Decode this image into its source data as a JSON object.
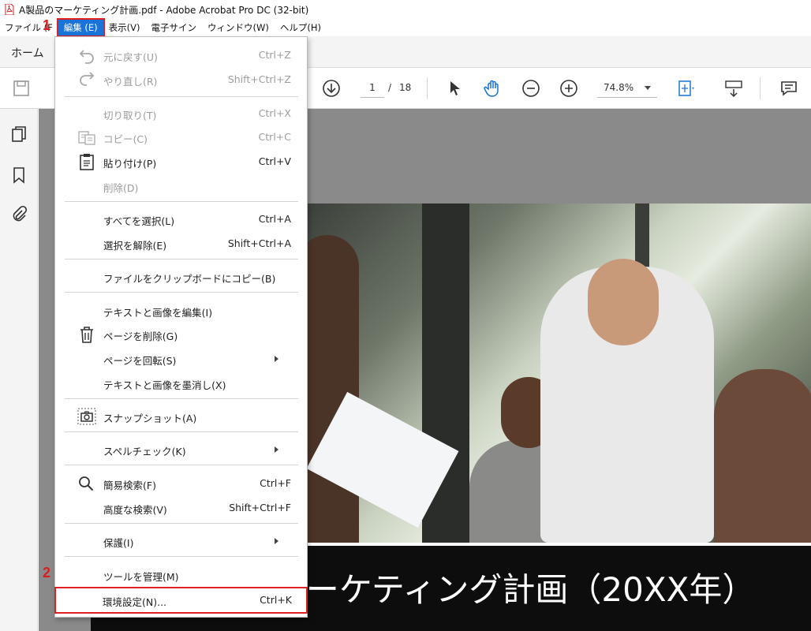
{
  "window": {
    "title": "A製品のマーケティング計画.pdf - Adobe Acrobat Pro DC (32-bit)"
  },
  "menubar": {
    "items": [
      "ファイル (F)",
      "編集 (E)",
      "表示(V)",
      "電子サイン",
      "ウィンドウ(W)",
      "ヘルプ(H)"
    ],
    "visible_first": "ファイル (F",
    "active_index": 1
  },
  "tabs": {
    "home": "ホーム"
  },
  "toolbar": {
    "page_current": "1",
    "page_sep": "/",
    "page_total": "18",
    "zoom": "74.8%"
  },
  "edit_menu": {
    "items": [
      {
        "label": "元に戻す(U)",
        "shortcut": "Ctrl+Z",
        "disabled": true,
        "icon": "undo-icon"
      },
      {
        "label": "やり直し(R)",
        "shortcut": "Shift+Ctrl+Z",
        "disabled": true,
        "icon": "redo-icon"
      },
      {
        "label": "切り取り(T)",
        "shortcut": "Ctrl+X",
        "disabled": true
      },
      {
        "label": "コピー(C)",
        "shortcut": "Ctrl+C",
        "disabled": true,
        "icon": "copy-icon"
      },
      {
        "label": "貼り付け(P)",
        "shortcut": "Ctrl+V",
        "disabled": false,
        "icon": "paste-icon"
      },
      {
        "label": "削除(D)",
        "shortcut": "",
        "disabled": true
      },
      {
        "label": "すべてを選択(L)",
        "shortcut": "Ctrl+A",
        "disabled": false
      },
      {
        "label": "選択を解除(E)",
        "shortcut": "Shift+Ctrl+A",
        "disabled": false
      },
      {
        "label": "ファイルをクリップボードにコピー(B)",
        "shortcut": "",
        "disabled": false
      },
      {
        "label": "テキストと画像を編集(I)",
        "shortcut": "",
        "disabled": false
      },
      {
        "label": "ページを削除(G)",
        "shortcut": "",
        "disabled": false,
        "icon": "trash-icon"
      },
      {
        "label": "ページを回転(S)",
        "shortcut": "",
        "disabled": false,
        "submenu": true
      },
      {
        "label": "テキストと画像を墨消し(X)",
        "shortcut": "",
        "disabled": false
      },
      {
        "label": "スナップショット(A)",
        "shortcut": "",
        "disabled": false,
        "icon": "camera-icon"
      },
      {
        "label": "スペルチェック(K)",
        "shortcut": "",
        "disabled": false,
        "submenu": true
      },
      {
        "label": "簡易検索(F)",
        "shortcut": "Ctrl+F",
        "disabled": false,
        "icon": "search-icon"
      },
      {
        "label": "高度な検索(V)",
        "shortcut": "Shift+Ctrl+F",
        "disabled": false
      },
      {
        "label": "保護(I)",
        "shortcut": "",
        "disabled": false,
        "submenu": true
      },
      {
        "label": "ツールを管理(M)",
        "shortcut": "",
        "disabled": false
      },
      {
        "label": "環境設定(N)...",
        "shortcut": "Ctrl+K",
        "disabled": false
      }
    ]
  },
  "document": {
    "banner_text": "A製品のマーケティング計画（20XX年）"
  },
  "callouts": {
    "one": "1",
    "two": "2"
  },
  "colors": {
    "menu_active": "#1a73d9",
    "callout_red": "#d62020",
    "doc_bg": "#8a8a8a"
  }
}
